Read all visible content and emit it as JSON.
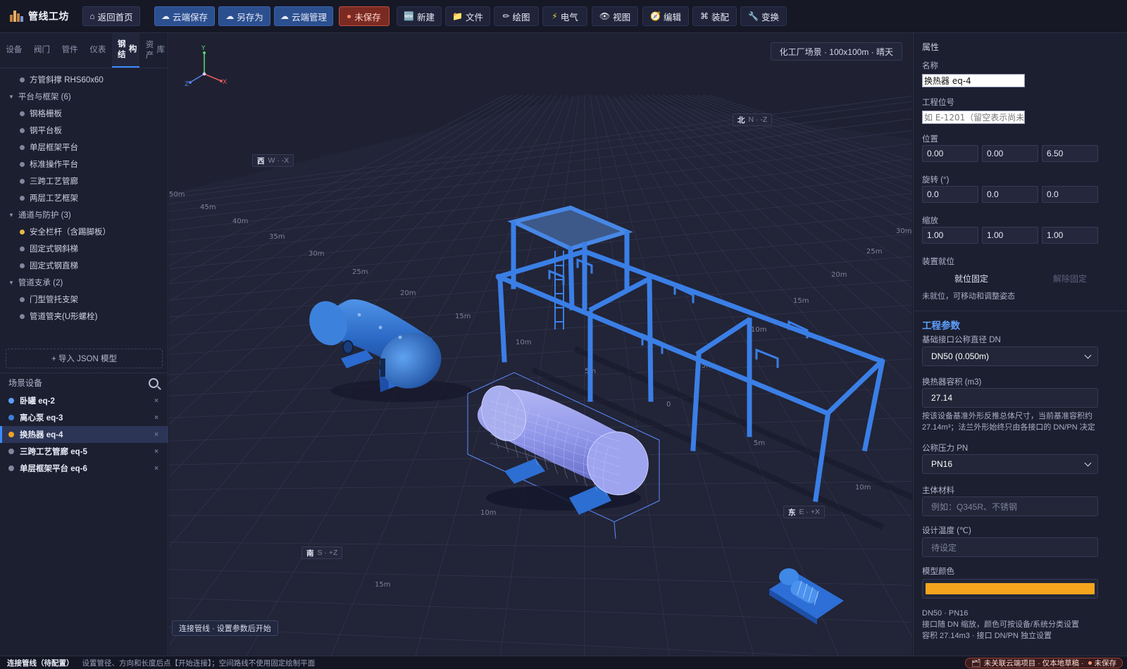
{
  "app": {
    "title": "管线工坊"
  },
  "toolbar": {
    "home": "返回首页",
    "cloud_save": "云端保存",
    "save_as": "另存为",
    "cloud_manage": "云端管理",
    "unsaved": "未保存",
    "new": "新建",
    "file": "文件",
    "draw": "绘图",
    "electric": "电气",
    "view": "视图",
    "edit": "编辑",
    "assembly": "装配",
    "transform": "变换"
  },
  "sidebar": {
    "tabs": [
      "设备",
      "阀门",
      "管件",
      "仪表",
      "钢结构",
      "资产库"
    ],
    "tabs_wrapped": {
      "4": [
        "钢结",
        "构"
      ],
      "5": [
        "资产",
        "库"
      ]
    },
    "active_tab": 4,
    "tree": {
      "top_item": "方管斜撑 RHS60x60",
      "groups": [
        {
          "name": "平台与框架 (6)",
          "items": [
            "钢格栅板",
            "钢平台板",
            "单层框架平台",
            "标准操作平台",
            "三跨工艺管廊",
            "两层工艺框架"
          ]
        },
        {
          "name": "通道与防护 (3)",
          "items": [
            "安全栏杆（含踢脚板）",
            "固定式钢斜梯",
            "固定式钢直梯"
          ]
        },
        {
          "name": "管道支承 (2)",
          "items": [
            "门型管托支架",
            "管道管夹(U形螺栓)"
          ]
        }
      ]
    },
    "import_button": "+ 导入 JSON 模型",
    "scene_title": "场景设备",
    "scene_items": [
      {
        "label": "卧罐 eq-2",
        "color": "#5ea0ff"
      },
      {
        "label": "离心泵 eq-3",
        "color": "#3c7fd8"
      },
      {
        "label": "换热器 eq-4",
        "color": "#f0a21e",
        "active": true
      },
      {
        "label": "三跨工艺管廊 eq-5",
        "color": "#7f87a0"
      },
      {
        "label": "单层框架平台 eq-6",
        "color": "#7f87a0"
      }
    ]
  },
  "viewport": {
    "scene_badge": "化工厂场景 · 100x100m · 晴天",
    "axes": {
      "x": "X",
      "y": "Y",
      "z": "Z"
    },
    "directions": {
      "west": {
        "main": "西",
        "sub": "W · -X"
      },
      "north": {
        "main": "北",
        "sub": "N · -Z"
      },
      "east": {
        "main": "东",
        "sub": "E · +X"
      },
      "south": {
        "main": "南",
        "sub": "S · +Z"
      }
    },
    "distance_labels": [
      "50m",
      "45m",
      "40m",
      "35m",
      "30m",
      "25m",
      "20m",
      "15m",
      "10m",
      "5m",
      "0",
      "5m",
      "10m",
      "15m",
      "20m",
      "25m",
      "30m",
      "5m",
      "10m",
      "15m",
      "10m",
      "5m"
    ],
    "hint": "连接管线 · 设置参数后开始"
  },
  "properties": {
    "title": "属性",
    "name_label": "名称",
    "name_value": "换热器 eq-4",
    "tag_label": "工程位号",
    "tag_placeholder": "如 E-1201（留空表示尚未",
    "position_label": "位置",
    "position": [
      "0.00",
      "0.00",
      "6.50"
    ],
    "rotation_label": "旋转 (°)",
    "rotation": [
      "0.0",
      "0.0",
      "0.0"
    ],
    "scale_label": "缩放",
    "scale": [
      "1.00",
      "1.00",
      "1.00"
    ],
    "mount_label": "装置就位",
    "lock_on": "就位固定",
    "lock_off": "解除固定",
    "mount_note": "未就位，可移动和调整姿态"
  },
  "engineering": {
    "title": "工程参数",
    "dn_label": "基础接口公称直径 DN",
    "dn_value": "DN50 (0.050m)",
    "volume_label": "换热器容积 (m3)",
    "volume_value": "27.14",
    "volume_note": "按该设备基准外形反推总体尺寸，当前基准容积约 27.14m³；法兰外形始终只由各接口的 DN/PN 决定",
    "pn_label": "公称压力 PN",
    "pn_value": "PN16",
    "material_label": "主体材料",
    "material_placeholder": "例如：Q345R、不锈钢",
    "temp_label": "设计温度 (℃)",
    "temp_placeholder": "待设定",
    "color_label": "模型颜色",
    "color_value": "#f4a41d",
    "summary": [
      "DN50 · PN16",
      "接口随 DN 缩放，颜色可按设备/系统分类设置",
      "容积 27.14m3 · 接口 DN/PN 独立设置"
    ]
  },
  "status": {
    "mode": "连接管线（待配置）",
    "message": "设置管径、方向和长度后点【开始连接】；空间路线不使用固定绘制平面",
    "project": "未关联云端项目 · 仅本地草稿 ·",
    "unsaved": "未保存"
  }
}
